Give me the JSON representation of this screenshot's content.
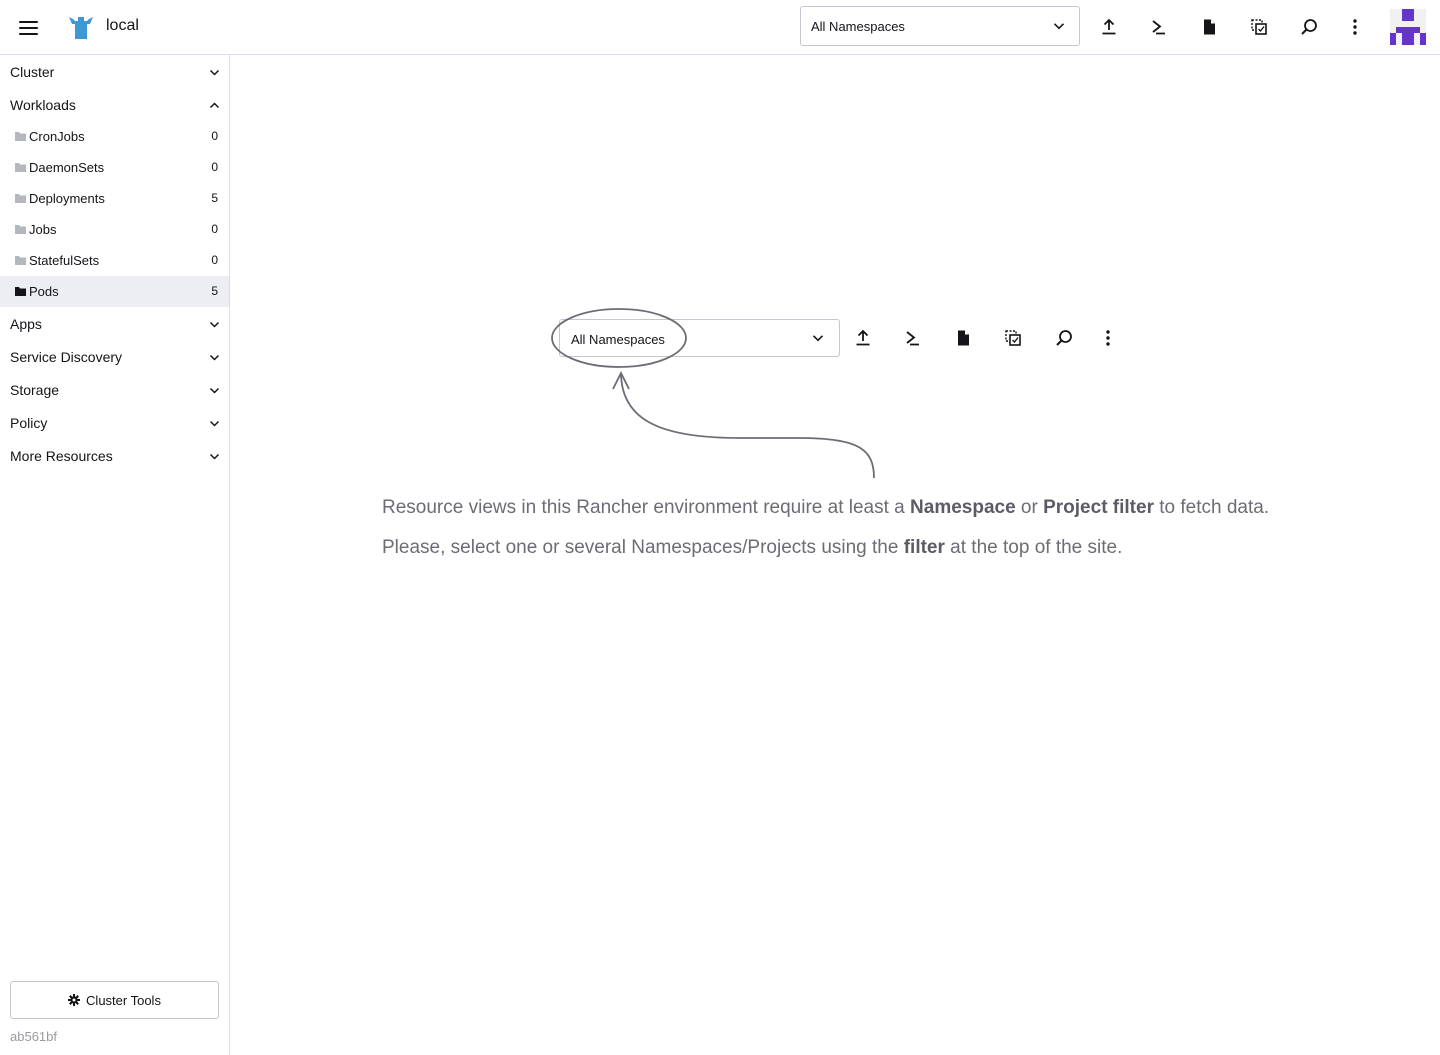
{
  "header": {
    "cluster_name": "local",
    "namespace_filter": "All Namespaces",
    "icons": [
      "menu-icon",
      "cluster-logo-icon",
      "chevron-down-icon",
      "import-yaml-icon",
      "kubectl-shell-icon",
      "kubeconfig-file-icon",
      "copy-kubeconfig-icon",
      "search-icon",
      "more-actions-icon"
    ],
    "avatar_color": "#6633cc"
  },
  "sidebar": {
    "groups": [
      {
        "label": "Cluster",
        "expanded": false
      },
      {
        "label": "Workloads",
        "expanded": true
      },
      {
        "label": "Apps",
        "expanded": false
      },
      {
        "label": "Service Discovery",
        "expanded": false
      },
      {
        "label": "Storage",
        "expanded": false
      },
      {
        "label": "Policy",
        "expanded": false
      },
      {
        "label": "More Resources",
        "expanded": false
      }
    ],
    "workload_items": [
      {
        "label": "CronJobs",
        "count": "0",
        "active": false
      },
      {
        "label": "DaemonSets",
        "count": "0",
        "active": false
      },
      {
        "label": "Deployments",
        "count": "5",
        "active": false
      },
      {
        "label": "Jobs",
        "count": "0",
        "active": false
      },
      {
        "label": "StatefulSets",
        "count": "0",
        "active": false
      },
      {
        "label": "Pods",
        "count": "5",
        "active": true
      }
    ],
    "cluster_tools_label": "Cluster Tools",
    "version": "ab561bf"
  },
  "main": {
    "demo_filter": "All Namespaces",
    "message_line1": [
      "Resource views in this Rancher environment require at least a ",
      "Namespace",
      " or ",
      "Project filter",
      " to fetch data."
    ],
    "message_line2": [
      "Please, select one or several Namespaces/Projects using the ",
      "filter",
      " at the top of the site."
    ],
    "annotation_color": "#6c6c76"
  }
}
